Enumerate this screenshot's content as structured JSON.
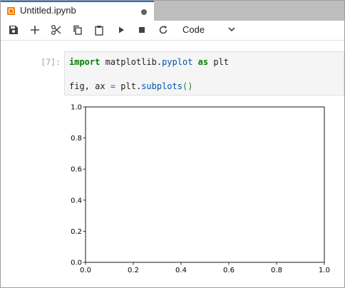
{
  "tab": {
    "title": "Untitled.ipynb",
    "icon": "notebook-icon",
    "dirty_indicator": true
  },
  "toolbar": {
    "buttons": [
      {
        "name": "save",
        "icon": "save-icon"
      },
      {
        "name": "insert-cell",
        "icon": "plus-icon"
      },
      {
        "name": "cut",
        "icon": "scissors-icon"
      },
      {
        "name": "copy",
        "icon": "copy-icon"
      },
      {
        "name": "paste",
        "icon": "paste-icon"
      },
      {
        "name": "run",
        "icon": "play-icon"
      },
      {
        "name": "interrupt",
        "icon": "stop-icon"
      },
      {
        "name": "restart",
        "icon": "restart-icon"
      }
    ],
    "cell_type": "Code"
  },
  "cell": {
    "prompt": "[7]:",
    "line1": {
      "kw1": "import",
      "mod1": "matplotlib.",
      "mod2": "pyplot",
      "kw2": "as",
      "alias": "plt"
    },
    "line2": {
      "lhs": "fig, ax",
      "op": "=",
      "obj": "plt.",
      "fn": "subplots",
      "paren": "()"
    }
  },
  "chart_data": {
    "type": "scatter",
    "series": [],
    "xlim": [
      0.0,
      1.0
    ],
    "ylim": [
      0.0,
      1.0
    ],
    "xticks": [
      "0.0",
      "0.2",
      "0.4",
      "0.6",
      "0.8",
      "1.0"
    ],
    "yticks": [
      "0.0",
      "0.2",
      "0.4",
      "0.6",
      "0.8",
      "1.0"
    ],
    "title": "",
    "xlabel": "",
    "ylabel": "",
    "grid": false
  },
  "colors": {
    "tab_accent": "#1976d2",
    "notebook_icon": "#f57c00",
    "keyword": "#008000",
    "module": "#0055aa",
    "operator": "#aa22ff"
  }
}
